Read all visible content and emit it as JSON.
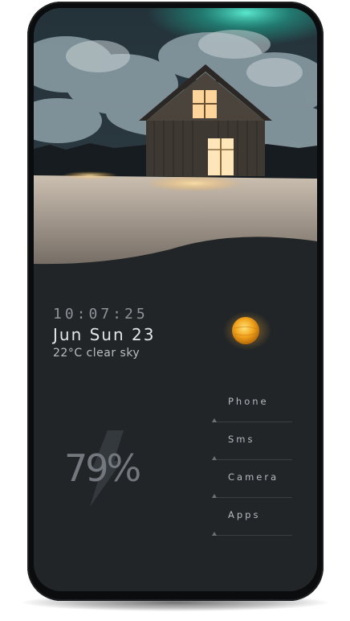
{
  "colors": {
    "screen_bg": "#222527",
    "accent_sun": "#f2a41c",
    "text_primary": "#e4e6e8",
    "text_muted": "#8e9398"
  },
  "clock": {
    "time": "10:07:25",
    "date": "Jun Sun 23"
  },
  "weather": {
    "summary": "22°C  clear sky",
    "icon": "sun-icon"
  },
  "battery": {
    "percent_text": "79%",
    "level": 0.79,
    "icon": "lightning-bolt-icon"
  },
  "apps": [
    {
      "label": "Phone"
    },
    {
      "label": "Sms"
    },
    {
      "label": "Camera"
    },
    {
      "label": "Apps"
    }
  ]
}
